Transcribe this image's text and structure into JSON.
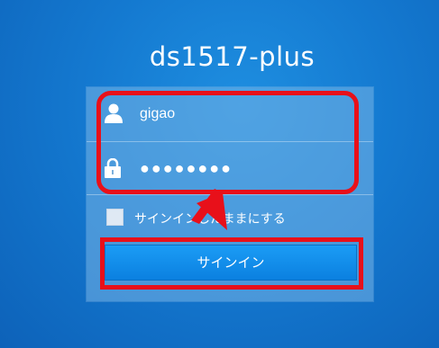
{
  "app": {
    "title": "ds1517-plus"
  },
  "login": {
    "username_value": "gigao",
    "password_mask": "●●●●●●●●",
    "remember_label": "サインインしたままにする",
    "signin_label": "サインイン"
  },
  "icons": {
    "user": "user-icon",
    "password": "lock-icon"
  },
  "colors": {
    "background": "#1479d0",
    "button": "#0b80e0",
    "highlight": "#e8101a"
  }
}
